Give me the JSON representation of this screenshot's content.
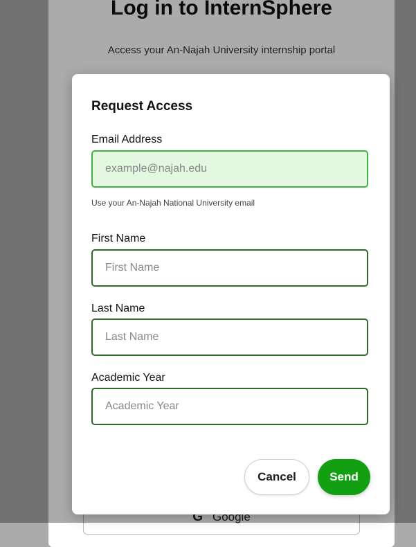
{
  "background": {
    "title": "Log in to InternSphere",
    "subtitle": "Access your An-Najah University internship portal",
    "google_label": "Google",
    "google_mark": "G"
  },
  "modal": {
    "title": "Request Access",
    "email": {
      "label": "Email Address",
      "placeholder": "example@najah.edu",
      "value": "",
      "hint": "Use your An-Najah National University email"
    },
    "first_name": {
      "label": "First Name",
      "placeholder": "First Name",
      "value": ""
    },
    "last_name": {
      "label": "Last Name",
      "placeholder": "Last Name",
      "value": ""
    },
    "academic_year": {
      "label": "Academic Year",
      "placeholder": "Academic Year",
      "value": ""
    },
    "cancel_label": "Cancel",
    "send_label": "Send"
  },
  "colors": {
    "accent_green": "#12a012",
    "focused_border": "#3fb23f",
    "focused_fill": "#e3f7e1",
    "field_border": "#2f6a2a"
  }
}
